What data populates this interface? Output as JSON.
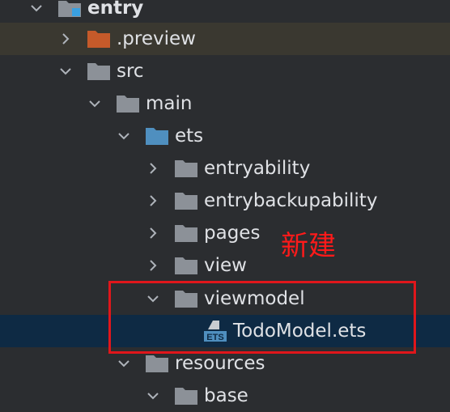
{
  "tree": {
    "items": [
      {
        "label": "entry",
        "icon": "module-folder-icon",
        "expanded": true
      },
      {
        "label": ".preview",
        "icon": "orange-folder-icon",
        "expanded": false
      },
      {
        "label": "src",
        "icon": "folder-icon",
        "expanded": true
      },
      {
        "label": "main",
        "icon": "folder-icon",
        "expanded": true
      },
      {
        "label": "ets",
        "icon": "blue-source-folder-icon",
        "expanded": true
      },
      {
        "label": "entryability",
        "icon": "folder-icon",
        "expanded": false
      },
      {
        "label": "entrybackupability",
        "icon": "folder-icon",
        "expanded": false
      },
      {
        "label": "pages",
        "icon": "folder-icon",
        "expanded": false
      },
      {
        "label": "view",
        "icon": "folder-icon",
        "expanded": false
      },
      {
        "label": "viewmodel",
        "icon": "folder-icon",
        "expanded": true
      },
      {
        "label": "TodoModel.ets",
        "icon": "ets-file-icon",
        "selected": true
      },
      {
        "label": "resources",
        "icon": "folder-icon",
        "expanded": true
      },
      {
        "label": "base",
        "icon": "folder-icon",
        "expanded": true
      }
    ]
  },
  "file_icon_text": "ETS",
  "annotation": {
    "text": "新建",
    "color": "#e0161b"
  },
  "colors": {
    "background": "#2b2d30",
    "selected_row": "#0e2a44",
    "folder_gray": "#8c9198",
    "folder_orange": "#c55a2a",
    "folder_blue": "#4f8fbf",
    "module_dot": "#3aa0e0"
  }
}
